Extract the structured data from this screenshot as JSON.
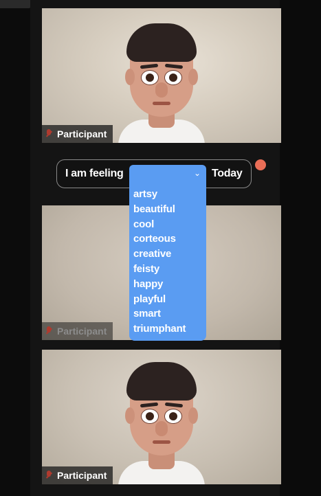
{
  "participants": [
    {
      "name": "Participant"
    },
    {
      "name": "Participant"
    },
    {
      "name": "Participant"
    }
  ],
  "feeling_bar": {
    "prefix": "I am feeling",
    "suffix": "Today",
    "selected_value": ""
  },
  "dropdown_options": [
    "artsy",
    "beautiful",
    "cool",
    "corteous",
    "creative",
    "feisty",
    "happy",
    "playful",
    "smart",
    "triumphant"
  ],
  "colors": {
    "accent": "#5a9cf2",
    "notification": "#ea6e57",
    "muted_mic": "#b03a2e"
  },
  "icons": {
    "mic_muted": "mic-muted-icon",
    "chevron": "chevron-down-icon"
  }
}
